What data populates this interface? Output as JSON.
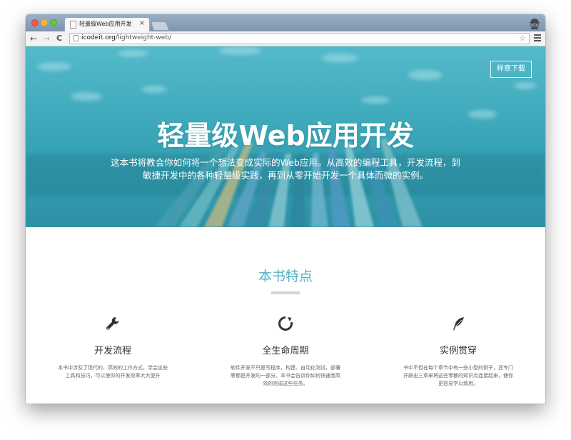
{
  "browser": {
    "tab_title": "轻量级Web应用开发",
    "tab_close": "×",
    "url_domain": "icodeit.org",
    "url_path": "/lightweight-web/",
    "back": "←",
    "forward": "→",
    "reload": "C",
    "bookmark_star": "☆"
  },
  "hero": {
    "sample_button": "样章下载",
    "title": "轻量级Web应用开发",
    "description_line1": "这本书将教会你如何将一个想法变成实际的Web应用。从高效的编程工具，开发流程，到",
    "description_line2": "敏捷开发中的各种轻量级实践，再到从零开始开发一个具体而微的实例。"
  },
  "features": {
    "section_title": "本书特点",
    "items": [
      {
        "icon": "wrench-icon",
        "title": "开发流程",
        "desc_line1": "本书中涉及了现代的、高效的工作方式，学会这些",
        "desc_line2": "工具和技巧，可以使你的开发效率大大提升"
      },
      {
        "icon": "circle-arrow-icon",
        "title": "全生命周期",
        "desc_line1": "软件开发不只是写程序，构建、自动化测试，部署",
        "desc_line2": "等都是开发的一部分。本书会告诉你如何快速而高",
        "desc_line3": "效的完成这些任务。"
      },
      {
        "icon": "feather-icon",
        "title": "实例贯穿",
        "desc_line1": "书中不但在每个章节中有一些小型的例子，还专门",
        "desc_line2": "开辟出三章来将这些零散的知识点连接起来，使你",
        "desc_line3": "更容易学以致用。"
      }
    ]
  },
  "colors": {
    "accent": "#4fb3c6",
    "hero_bg": "#3aa7b9"
  }
}
